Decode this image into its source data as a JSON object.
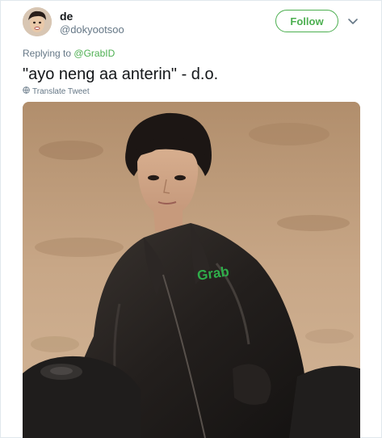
{
  "tweet": {
    "display_name": "de",
    "handle": "@dokyootsoo",
    "follow_label": "Follow",
    "replying_to_prefix": "Replying to",
    "replying_to_mention": "@GrabID",
    "text": "\"ayo neng aa anterin\" - d.o.",
    "translate_label": "Translate Tweet",
    "jacket_logo_text": "Grab"
  },
  "colors": {
    "accent": "#4caf50",
    "secondary_text": "#657786",
    "primary_text": "#14171a"
  },
  "icons": {
    "caret": "chevron-down-icon",
    "translate": "globe-icon"
  }
}
